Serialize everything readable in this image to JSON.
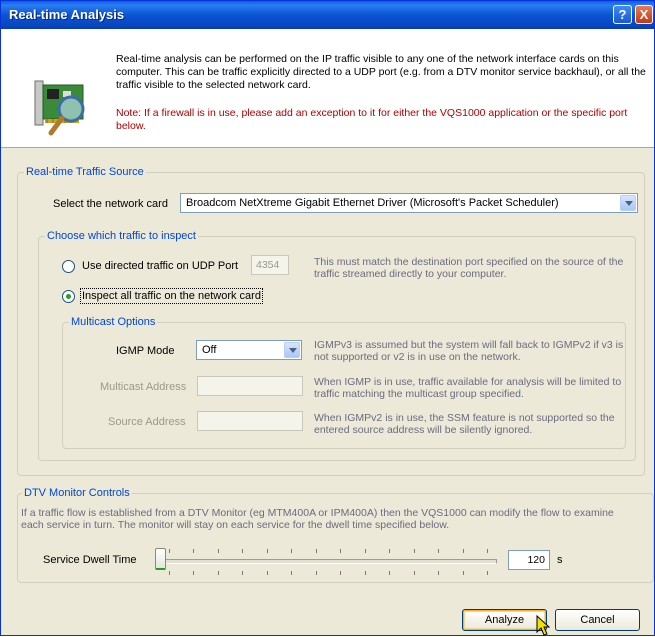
{
  "window": {
    "title": "Real-time Analysis",
    "help_button": "?",
    "close_button": "X"
  },
  "intro": {
    "text": "Real-time analysis can be performed on the IP traffic visible to any one of the network interface cards on this computer. This can be traffic explicitly directed to a UDP port (e.g. from a DTV monitor service backhaul), or all the traffic visible to the selected network card.",
    "note": "Note: If a firewall is in use, please add an exception to it for either the VQS1000 application or the specific port below."
  },
  "source": {
    "legend": "Real-time Traffic Source",
    "card_label": "Select the network card",
    "card_value": "Broadcom NetXtreme Gigabit Ethernet Driver (Microsoft's Packet Scheduler)",
    "inspect": {
      "legend": "Choose which traffic to inspect",
      "udp_label": "Use directed traffic on UDP Port",
      "udp_port": "4354",
      "udp_desc": "This must match the destination port specified on the source of the traffic streamed directly to your computer.",
      "all_label": "Inspect all traffic on the network card",
      "selected": "all"
    },
    "multicast": {
      "legend": "Multicast Options",
      "igmp_label": "IGMP Mode",
      "igmp_value": "Off",
      "igmp_desc": "IGMPv3 is assumed but the system will fall back to IGMPv2 if v3 is not supported or v2 is in use on the network.",
      "address_label": "Multicast Address",
      "address_value": "",
      "address_desc": "When IGMP is in use, traffic available for analysis will be limited to traffic matching the multicast group specified.",
      "source_label": "Source Address",
      "source_value": "",
      "source_desc": "When IGMPv2 is in use, the SSM feature is not supported so the entered source address will be silently ignored."
    }
  },
  "dtv": {
    "legend": "DTV Monitor Controls",
    "desc": "If a traffic flow is established from a DTV Monitor (eg MTM400A or IPM400A) then the VQS1000 can modify the flow to examine each service in turn. The monitor will stay on each service for the dwell time specified below.",
    "dwell_label": "Service Dwell Time",
    "dwell_value": "120",
    "dwell_unit": "s",
    "slider_level": 0
  },
  "buttons": {
    "analyze": "Analyze",
    "cancel": "Cancel"
  },
  "colors": {
    "title_bar": "#0a5fe6",
    "legend": "#0046d5",
    "note": "#b00000",
    "desc": "#6b6b80"
  },
  "icons": {
    "banner": "network-card-magnifier-icon",
    "help": "help-icon",
    "close": "close-icon",
    "cursor": "pointer-cursor-icon"
  }
}
